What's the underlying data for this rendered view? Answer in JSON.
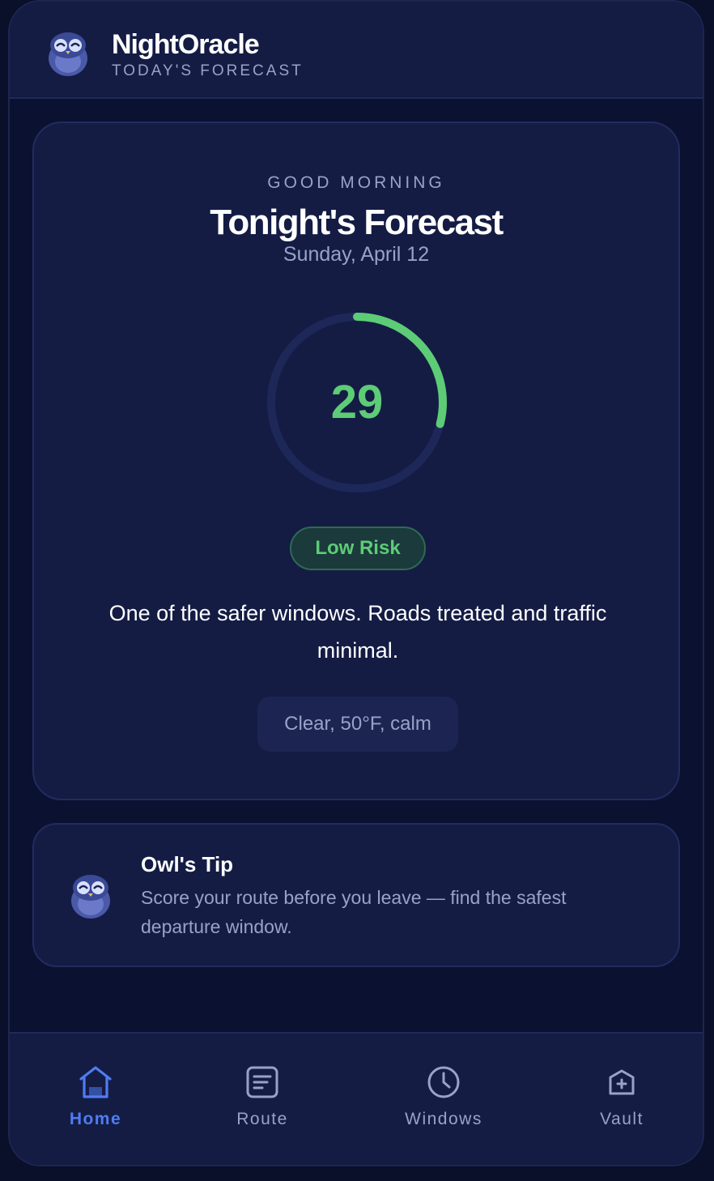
{
  "header": {
    "app_name": "NightOracle",
    "subtitle": "TODAY'S FORECAST",
    "logo_icon": "owl-icon"
  },
  "forecast": {
    "greeting": "GOOD MORNING",
    "title": "Tonight's Forecast",
    "date": "Sunday, April 12",
    "score": "29",
    "score_fraction": 0.29,
    "risk_label": "Low Risk",
    "description": "One of the safer windows. Roads treated and traffic minimal.",
    "weather": "Clear, 50°F, calm",
    "accent_color": "#5dcc76"
  },
  "tip": {
    "title": "Owl's Tip",
    "text": "Score your route before you leave — find the safest departure window.",
    "icon": "owl-icon"
  },
  "nav": {
    "items": [
      {
        "label": "Home",
        "icon": "home-icon",
        "active": true
      },
      {
        "label": "Route",
        "icon": "route-icon",
        "active": false
      },
      {
        "label": "Windows",
        "icon": "clock-icon",
        "active": false
      },
      {
        "label": "Vault",
        "icon": "vault-icon",
        "active": false
      }
    ],
    "active_color": "#4f7cf2"
  }
}
